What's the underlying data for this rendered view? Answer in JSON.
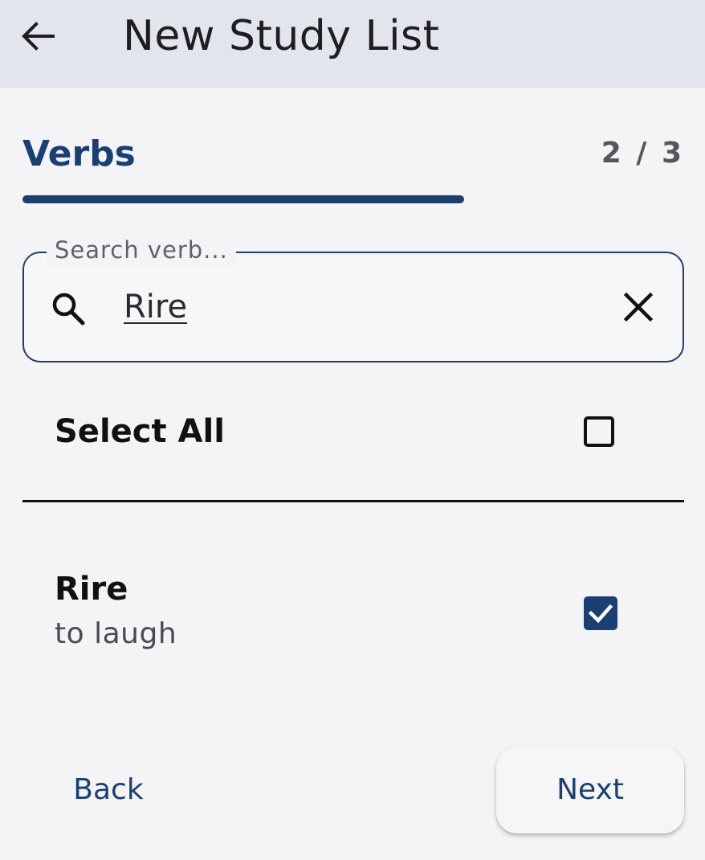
{
  "app_bar": {
    "title": "New Study List",
    "back_icon": "arrow-left-icon"
  },
  "step": {
    "title": "Verbs",
    "counter": "2 / 3",
    "progress": 0.667
  },
  "search": {
    "label": "Search verb...",
    "value": "Rire",
    "search_icon": "search-icon",
    "clear_icon": "close-icon"
  },
  "select_all": {
    "label": "Select All",
    "checked": false
  },
  "verbs": [
    {
      "title": "Rire",
      "translation": "to laugh",
      "checked": true
    }
  ],
  "actions": {
    "back_label": "Back",
    "next_label": "Next"
  },
  "colors": {
    "accent": "#1a3f73",
    "app_bar_bg": "#e2e5ec",
    "page_bg": "#f4f4f7"
  }
}
